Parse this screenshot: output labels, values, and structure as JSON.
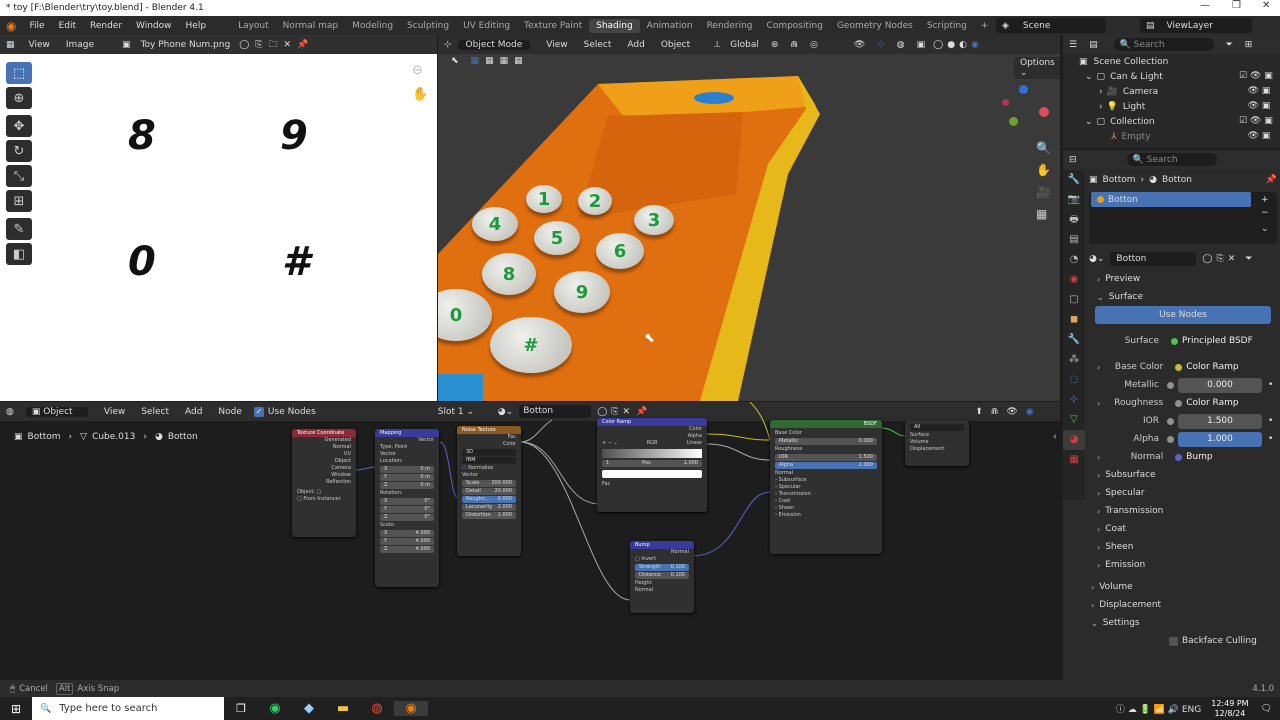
{
  "window": {
    "title": "* toy [F:\\Blender\\try\\toy.blend] - Blender 4.1"
  },
  "menu": [
    "File",
    "Edit",
    "Render",
    "Window",
    "Help"
  ],
  "workspaces": [
    "Layout",
    "Normal map",
    "Modeling",
    "Sculpting",
    "UV Editing",
    "Texture Paint",
    "Shading",
    "Animation",
    "Rendering",
    "Compositing",
    "Geometry Nodes",
    "Scripting"
  ],
  "active_workspace": "Shading",
  "scene": "Scene",
  "view_layer": "ViewLayer",
  "image_editor": {
    "menus": [
      "View",
      "Image"
    ],
    "image_name": "Toy Phone Num.png",
    "glyphs": [
      "8",
      "9",
      "0",
      "#"
    ]
  },
  "viewport": {
    "mode": "Object Mode",
    "menus": [
      "View",
      "Select",
      "Add",
      "Object"
    ],
    "orientation": "Global",
    "options": "Options",
    "keys": [
      "1",
      "2",
      "3",
      "4",
      "5",
      "6",
      "8",
      "9",
      "0",
      "#"
    ]
  },
  "outliner": {
    "search_placeholder": "Search",
    "root": "Scene Collection",
    "items": [
      {
        "label": "Can & Light"
      },
      {
        "label": "Camera"
      },
      {
        "label": "Light"
      },
      {
        "label": "Collection"
      },
      {
        "label": "Empty"
      }
    ]
  },
  "properties": {
    "search_placeholder": "Search",
    "breadcrumb": [
      "Bottom",
      "Botton"
    ],
    "material_slot": "Botton",
    "material_name": "Botton",
    "panels": {
      "preview": "Preview",
      "surface": "Surface",
      "volume": "Volume",
      "displacement": "Displacement",
      "settings": "Settings"
    },
    "use_nodes": "Use Nodes",
    "surface_label": "Surface",
    "surface_value": "Principled BSDF",
    "rows": [
      {
        "label": "Base Color",
        "value": "Color Ramp"
      },
      {
        "label": "Metallic",
        "value": "0.000"
      },
      {
        "label": "Roughness",
        "value": "Color Ramp"
      },
      {
        "label": "IOR",
        "value": "1.500"
      },
      {
        "label": "Alpha",
        "value": "1.000"
      },
      {
        "label": "Normal",
        "value": "Bump"
      }
    ],
    "subsections": [
      "Subsurface",
      "Specular",
      "Transmission",
      "Coat",
      "Sheen",
      "Emission"
    ],
    "backface": "Backface Culling"
  },
  "node_editor": {
    "object_menu": "Object",
    "menus": [
      "View",
      "Select",
      "Add",
      "Node"
    ],
    "use_nodes": "Use Nodes",
    "slot": "Slot 1",
    "material": "Botton",
    "breadcrumb": [
      "Bottom",
      "Cube.013",
      "Botton"
    ],
    "nodes": {
      "texcoord": {
        "title": "Texture Coordinate",
        "outputs": [
          "Generated",
          "Normal",
          "UV",
          "Object",
          "Camera",
          "Window",
          "Reflection"
        ],
        "object_label": "Object:",
        "from_instancer": "From Instancer"
      },
      "mapping": {
        "title": "Mapping",
        "output": "Vector",
        "type_label": "Type:",
        "type_value": "Point",
        "vector": "Vector",
        "location": "Location:",
        "loc": [
          "0 m",
          "0 m",
          "0 m"
        ],
        "rotation": "Rotation:",
        "rot": [
          "0°",
          "0°",
          "0°"
        ],
        "scale": "Scale:",
        "scl": [
          "4.000",
          "4.000",
          "4.000"
        ],
        "axes": [
          "X",
          "Y",
          "Z"
        ]
      },
      "noise": {
        "title": "Noise Texture",
        "outputs": [
          "Fac",
          "Color"
        ],
        "dim": "3D",
        "kind": "fBM",
        "normalize": "Normalize",
        "vector": "Vector",
        "fields": [
          {
            "label": "Scale",
            "value": "200.000"
          },
          {
            "label": "Detail",
            "value": "20.000"
          },
          {
            "label": "Roughn...",
            "value": "0.000"
          },
          {
            "label": "Lacunarity",
            "value": "2.000"
          },
          {
            "label": "Distortion",
            "value": "1.000"
          }
        ]
      },
      "ramp": {
        "title": "Color Ramp",
        "outputs": [
          "Color",
          "Alpha"
        ],
        "mode": "RGB",
        "interp": "Linear",
        "index": "1",
        "pos_label": "Pos",
        "pos": "1.000",
        "input": "Fac"
      },
      "bump": {
        "title": "Bump",
        "output": "Normal",
        "invert": "Invert",
        "strength_label": "Strength",
        "strength": "0.100",
        "distance_label": "Distance",
        "distance": "0.100",
        "inputs": [
          "Height",
          "Normal"
        ]
      },
      "bsdf": {
        "title": "BSDF",
        "rows": [
          "Base Color",
          "Metallic",
          "Roughness",
          "IOR",
          "Alpha",
          "Normal"
        ],
        "values": [
          "0.000",
          "1.500",
          "1.000"
        ],
        "subs": [
          "Subsurface",
          "Specular",
          "Transmission",
          "Coat",
          "Sheen",
          "Emission"
        ]
      },
      "output": {
        "target": "All",
        "inputs": [
          "Surface",
          "Volume",
          "Displacement"
        ]
      }
    }
  },
  "status": {
    "cancel": "Cancel",
    "modifier": "Alt",
    "action": "Axis Snap",
    "version": "4.1.0"
  },
  "taskbar": {
    "search": "Type here to search",
    "time": "12:49 PM",
    "date": "12/8/24"
  }
}
